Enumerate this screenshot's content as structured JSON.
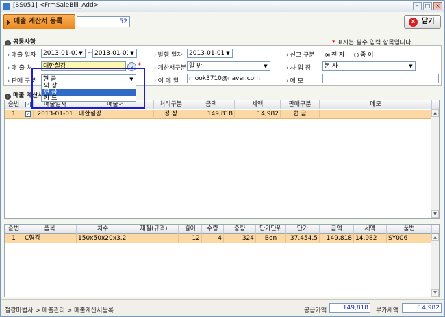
{
  "window": {
    "title": "[SS051] <FrmSaleBill_Add>"
  },
  "header": {
    "form_title": "매출 계산서 등록",
    "title_box_value": "52",
    "close_label": "닫기"
  },
  "common_section": {
    "title": "공통사항",
    "required_note": "표시는 필수 입력 항목입니다."
  },
  "fields": {
    "sale_date_label": "매출 일자",
    "sale_date_from": "2013-01-01",
    "sale_date_to": "2013-01-01",
    "issue_date_label": "발행 일자",
    "issue_date": "2013-01-01",
    "report_type_label": "신고 구분",
    "report_options": [
      "전 자",
      "종 이"
    ],
    "customer_label": "매 출 처",
    "customer_value": "대한철강",
    "invoice_type_label": "계산서구분",
    "invoice_type_value": "일 반",
    "business_label": "사 업 장",
    "business_value": "본 사",
    "sale_type_label": "판매 구분",
    "sale_type_value": "현 금",
    "email_label": "이 메 일",
    "email_value": "mook3710@naver.com",
    "memo_label": "메 모",
    "memo_value": ""
  },
  "dropdown": {
    "options": [
      "외 상",
      "현 금",
      "카 드"
    ],
    "selected_index": 1
  },
  "invoice_section": {
    "title": "매출 계산서"
  },
  "grid1": {
    "headers": [
      "순번",
      "",
      "매출일자",
      "매출처",
      "처리구분",
      "금액",
      "세액",
      "판매구분",
      "메모"
    ],
    "rows": [
      {
        "no": "1",
        "checked": "✓",
        "date": "2013-01-01",
        "customer": "대한철강",
        "process": "정 상",
        "amount": "149,818",
        "tax": "14,982",
        "sale_type": "현 금",
        "memo": ""
      }
    ]
  },
  "grid2": {
    "headers": [
      "순번",
      "품목",
      "치수",
      "재질(규격)",
      "길이",
      "수량",
      "중량",
      "단가단위",
      "단가",
      "금액",
      "세액",
      "품번"
    ],
    "rows": [
      {
        "no": "1",
        "item": "C형강",
        "size": "150x50x20x3.2",
        "material": "",
        "length": "12",
        "qty": "4",
        "weight": "324",
        "unit": "Bon",
        "price": "37,454.5",
        "amount": "149,818",
        "tax": "14,982",
        "part_no": "SY006"
      }
    ]
  },
  "status": {
    "breadcrumb": "철강마법사 > 매출관리 > 매출계산서등록",
    "supply_label": "공급가액",
    "supply_value": "149,818",
    "vat_label": "부가세액",
    "vat_value": "14,982"
  },
  "icons": {
    "search": "magnifier-icon",
    "close": "close-circle-icon"
  }
}
